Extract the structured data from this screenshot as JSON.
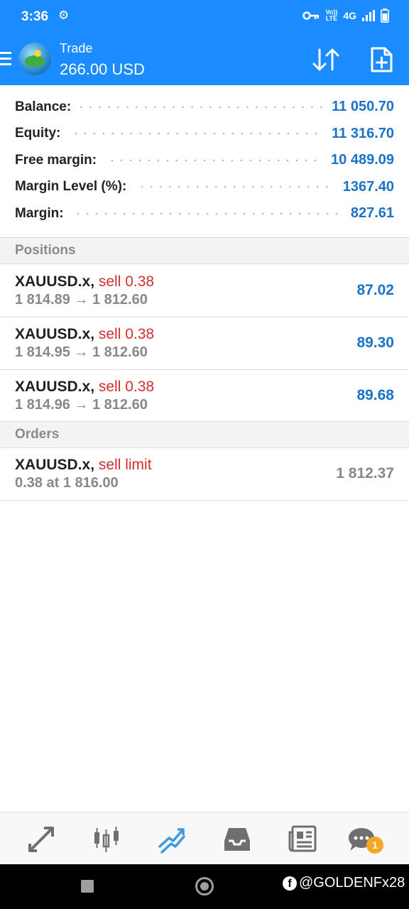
{
  "status": {
    "time": "3:36",
    "network": "4G",
    "volte_top": "Vo))",
    "volte_bottom": "LTE"
  },
  "header": {
    "title": "Trade",
    "subtitle": "266.00 USD"
  },
  "summary": [
    {
      "label": "Balance:",
      "value": "11 050.70"
    },
    {
      "label": "Equity:",
      "value": "11 316.70"
    },
    {
      "label": "Free margin:",
      "value": "10 489.09"
    },
    {
      "label": "Margin Level (%):",
      "value": "1367.40"
    },
    {
      "label": "Margin:",
      "value": "827.61"
    }
  ],
  "positions_header": "Positions",
  "positions": [
    {
      "symbol": "XAUUSD.x,",
      "type": "sell 0.38",
      "prices": "1 814.89 → 1 812.60",
      "profit": "87.02"
    },
    {
      "symbol": "XAUUSD.x,",
      "type": "sell 0.38",
      "prices": "1 814.95 → 1 812.60",
      "profit": "89.30"
    },
    {
      "symbol": "XAUUSD.x,",
      "type": "sell 0.38",
      "prices": "1 814.96 → 1 812.60",
      "profit": "89.68"
    }
  ],
  "orders_header": "Orders",
  "orders": [
    {
      "symbol": "XAUUSD.x,",
      "type": "sell limit",
      "detail": "0.38 at 1 816.00",
      "price": "1 812.37"
    }
  ],
  "tabs": [
    "quotes-tab",
    "chart-tab",
    "trade-tab",
    "history-tab",
    "news-tab",
    "messages-tab"
  ],
  "messages_badge": "1",
  "watermark": "@GOLDENFx28",
  "colors": {
    "header_blue": "#1a8cff",
    "value_blue": "#1a73c9",
    "sell_red": "#d32f2f"
  }
}
